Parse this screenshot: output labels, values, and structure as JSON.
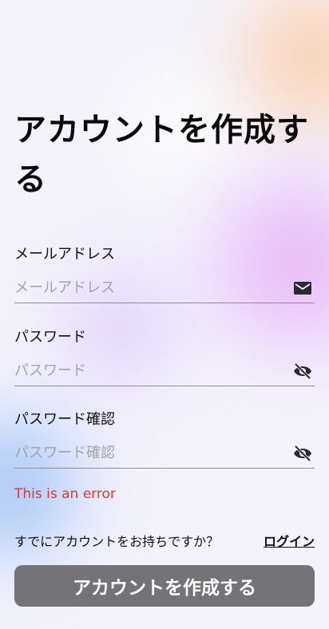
{
  "header": {
    "title": "アカウントを作成する"
  },
  "form": {
    "email": {
      "label": "メールアドレス",
      "placeholder": "メールアドレス",
      "icon": "mail-icon"
    },
    "password": {
      "label": "パスワード",
      "placeholder": "パスワード",
      "icon": "eye-off-icon"
    },
    "password_confirm": {
      "label": "パスワード確認",
      "placeholder": "パスワード確認",
      "icon": "eye-off-icon"
    },
    "error": "This is an error"
  },
  "login_prompt": {
    "text": "すでにアカウントをお持ちですか？",
    "link": "ログイン"
  },
  "submit": {
    "label": "アカウントを作成する"
  },
  "colors": {
    "error": "#e5362c",
    "button_bg": "#737378",
    "placeholder": "#a2a2a7"
  }
}
